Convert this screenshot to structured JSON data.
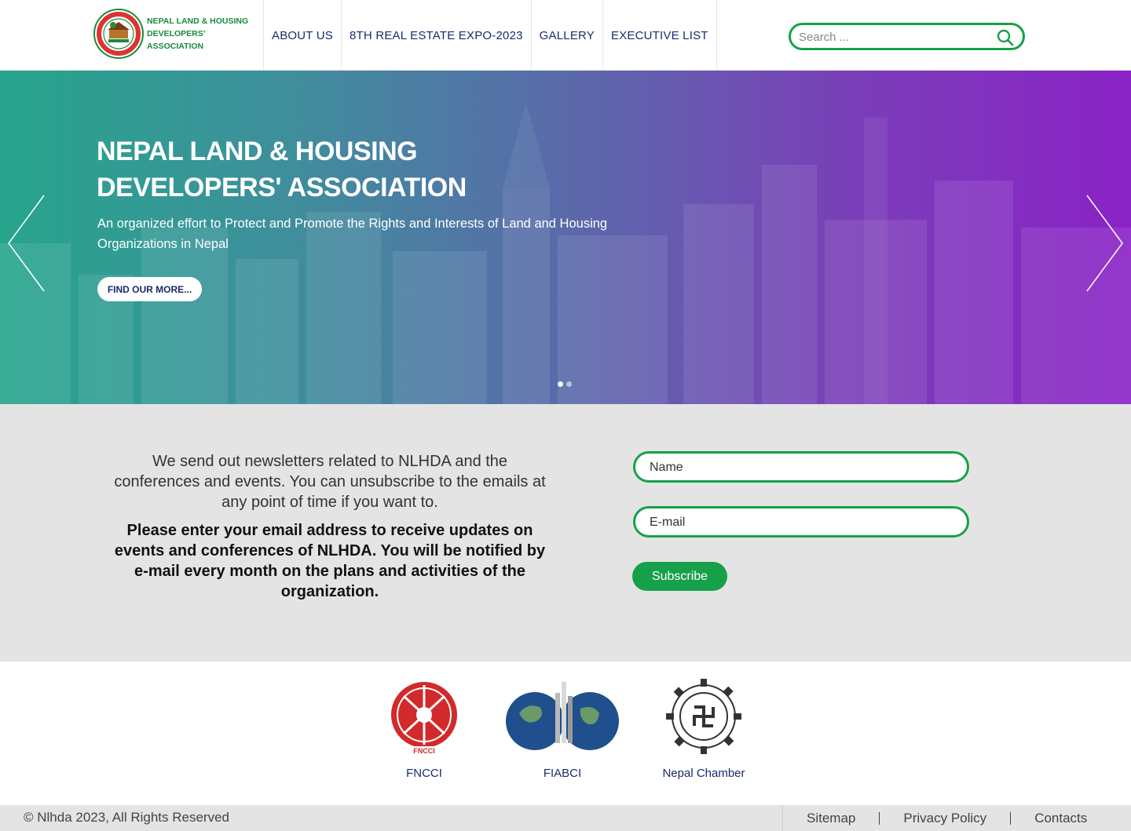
{
  "header": {
    "logo_text": "NEPAL LAND & HOUSING DEVELOPERS' ASSOCIATION",
    "nav": [
      "ABOUT US",
      "8TH REAL ESTATE EXPO-2023",
      "GALLERY",
      "EXECUTIVE LIST"
    ],
    "search_placeholder": "Search ..."
  },
  "hero": {
    "title": "NEPAL LAND & HOUSING DEVELOPERS' ASSOCIATION",
    "subtitle": "An organized effort to Protect and Promote the Rights and Interests of Land and Housing Organizations in Nepal",
    "button_label": "FIND OUR MORE...",
    "slide_count": 2,
    "active_slide": 1
  },
  "newsletter": {
    "text": "We send out newsletters related to NLHDA and the conferences and events. You can unsubscribe to the emails at any point of time if you want to.",
    "bold_text": "Please enter your email address to receive updates on events and conferences of NLHDA. You will be notified by e-mail every month on the plans and activities of the organization.",
    "name_placeholder": "Name",
    "email_placeholder": "E-mail",
    "subscribe_label": "Subscribe"
  },
  "partners": [
    {
      "name": "FNCCI",
      "icon": "fncci-logo"
    },
    {
      "name": "FIABCI",
      "icon": "fiabci-logo"
    },
    {
      "name": "Nepal Chamber",
      "icon": "nepal-chamber-logo"
    }
  ],
  "footer": {
    "copyright": "© Nlhda 2023, All Rights Reserved",
    "links": [
      "Sitemap",
      "Privacy Policy",
      "Contacts"
    ]
  },
  "colors": {
    "brand_green": "#17a04a",
    "nav_blue": "#1b2a6b",
    "hero_start": "#27a58c",
    "hero_end": "#8a22c6"
  }
}
